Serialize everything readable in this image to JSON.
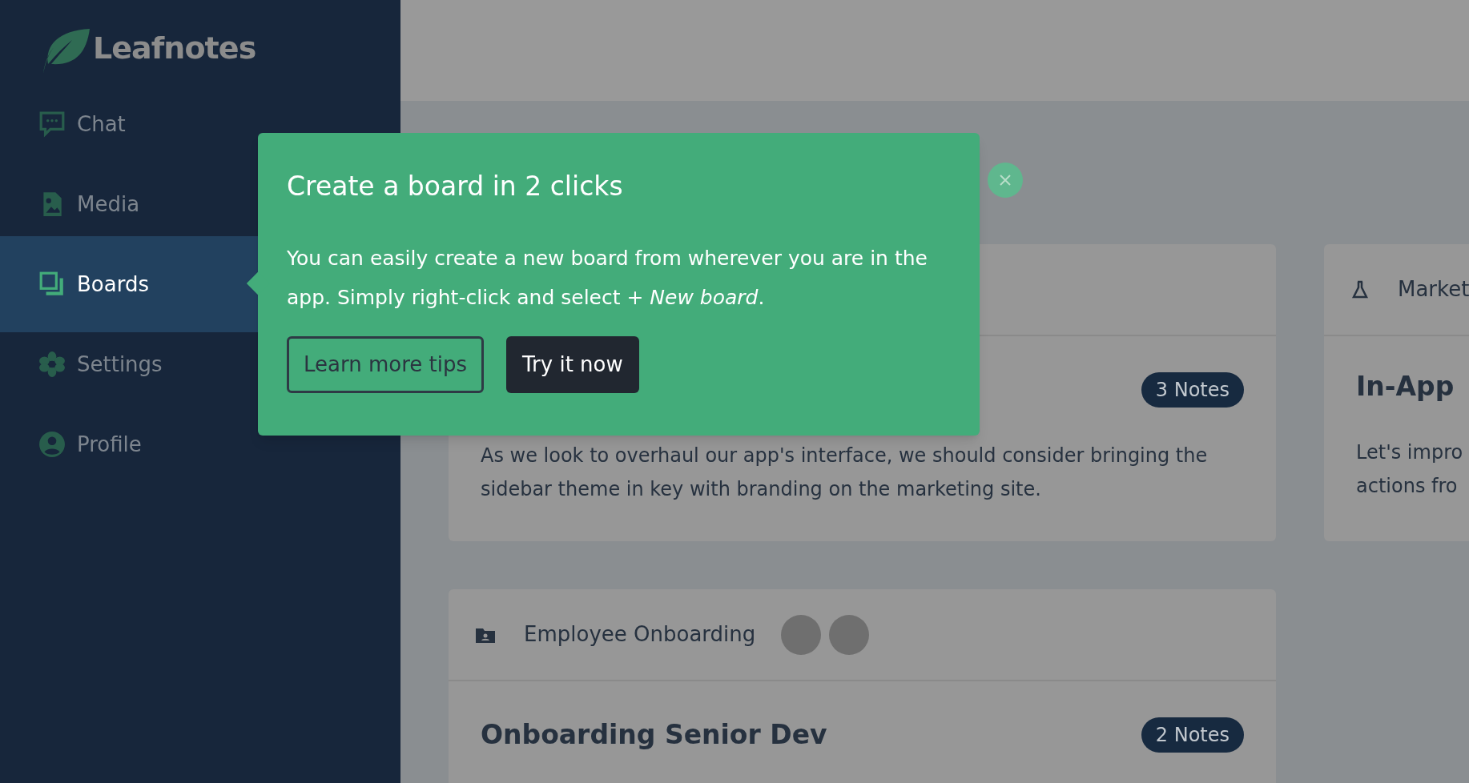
{
  "sidebar": {
    "logo": "Leafnotes",
    "items": [
      {
        "label": "Chat",
        "selected": false
      },
      {
        "label": "Media",
        "selected": false
      },
      {
        "label": "Boards",
        "selected": true
      },
      {
        "label": "Settings",
        "selected": false
      },
      {
        "label": "Profile",
        "selected": false
      }
    ]
  },
  "popover": {
    "title": "Create a board in 2 clicks",
    "body": "You can easily create a new board from wherever you are in the app. Simply right-click and select *+ New board*.",
    "buttons": [
      {
        "label": "Learn more tips",
        "kind": "outline"
      },
      {
        "label": "Try it now",
        "kind": "solid"
      }
    ]
  },
  "boards": [
    {
      "badge": "3 Notes",
      "lines": [
        "As we look to overhaul our app's interface, we should consider bringing the",
        "sidebar theme in key with branding on the marketing site."
      ]
    },
    {
      "header": "Market",
      "title": "In-App",
      "lines": [
        "Let's impro",
        "actions fro"
      ]
    },
    {
      "header": "Employee Onboarding",
      "members": [
        {
          "kind": "photo"
        },
        {
          "kind": "photo"
        }
      ],
      "title": "Onboarding Senior Dev",
      "badge": "2 Notes"
    }
  ]
}
